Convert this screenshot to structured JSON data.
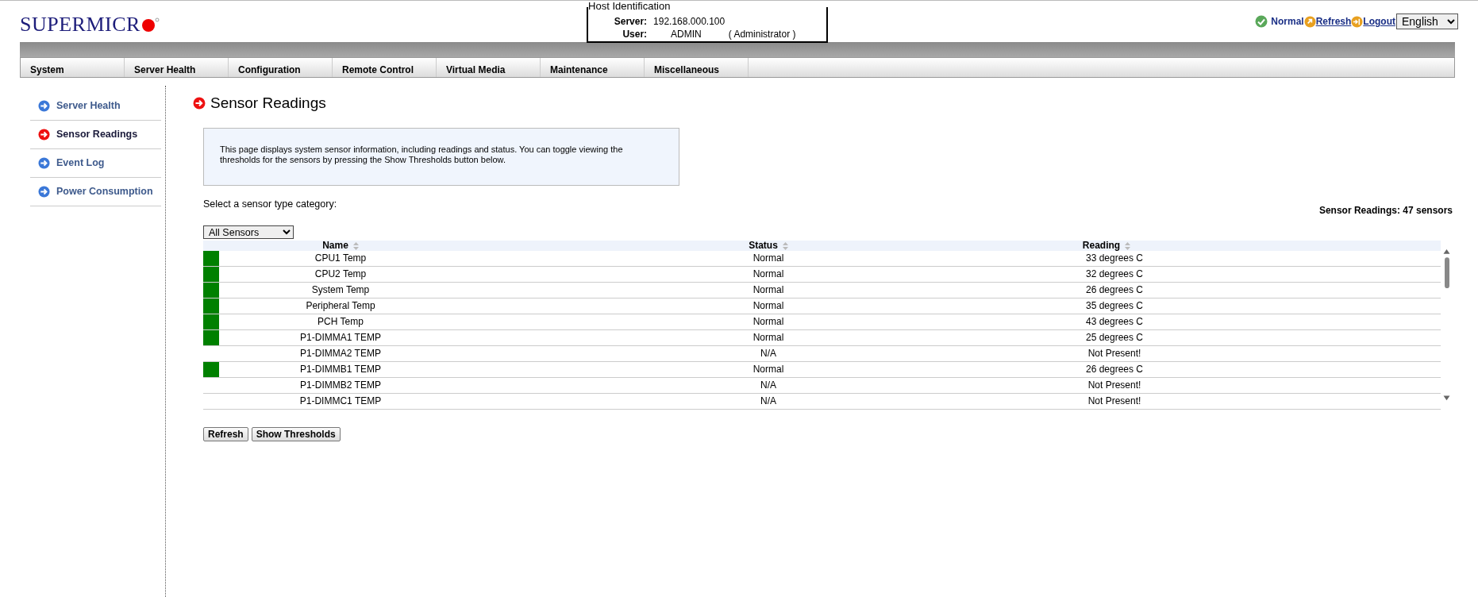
{
  "header": {
    "logo": "SUPERMICR",
    "host_identification": {
      "legend": "Host Identification",
      "server_label": "Server:",
      "server": "192.168.000.100",
      "user_label": "User:",
      "user": "ADMIN",
      "role": "( Administrator )"
    },
    "status": "Normal",
    "refresh": "Refresh",
    "logout": "Logout",
    "language": "English"
  },
  "menu": [
    {
      "label": "System"
    },
    {
      "label": "Server Health"
    },
    {
      "label": "Configuration"
    },
    {
      "label": "Remote Control"
    },
    {
      "label": "Virtual Media"
    },
    {
      "label": "Maintenance"
    },
    {
      "label": "Miscellaneous"
    }
  ],
  "sidebar": {
    "items": [
      {
        "label": "Server Health",
        "selected": false
      },
      {
        "label": "Sensor Readings",
        "selected": true
      },
      {
        "label": "Event Log",
        "selected": false
      },
      {
        "label": "Power Consumption",
        "selected": false
      }
    ]
  },
  "page_title": "Sensor Readings",
  "description": "This page displays system sensor information, including readings and status. You can toggle viewing the thresholds for the sensors by pressing the Show Thresholds button below.",
  "category_label": "Select a sensor type category:",
  "category": "All Sensors",
  "sensor_count": "Sensor Readings: 47 sensors",
  "table": {
    "columns": [
      "Name",
      "Status",
      "Reading"
    ],
    "rows": [
      {
        "color": "#008000",
        "name": "CPU1 Temp",
        "status": "Normal",
        "reading": "33 degrees C"
      },
      {
        "color": "#008000",
        "name": "CPU2 Temp",
        "status": "Normal",
        "reading": "32 degrees C"
      },
      {
        "color": "#008000",
        "name": "System Temp",
        "status": "Normal",
        "reading": "26 degrees C"
      },
      {
        "color": "#008000",
        "name": "Peripheral Temp",
        "status": "Normal",
        "reading": "35 degrees C"
      },
      {
        "color": "#008000",
        "name": "PCH Temp",
        "status": "Normal",
        "reading": "43 degrees C"
      },
      {
        "color": "#008000",
        "name": "P1-DIMMA1 TEMP",
        "status": "Normal",
        "reading": "25 degrees C"
      },
      {
        "name": "P1-DIMMA2 TEMP",
        "status": "N/A",
        "reading": "Not Present!"
      },
      {
        "color": "#008000",
        "name": "P1-DIMMB1 TEMP",
        "status": "Normal",
        "reading": "26 degrees C"
      },
      {
        "name": "P1-DIMMB2 TEMP",
        "status": "N/A",
        "reading": "Not Present!"
      },
      {
        "name": "P1-DIMMC1 TEMP",
        "status": "N/A",
        "reading": "Not Present!"
      }
    ]
  },
  "buttons": [
    "Refresh",
    "Show Thresholds"
  ]
}
